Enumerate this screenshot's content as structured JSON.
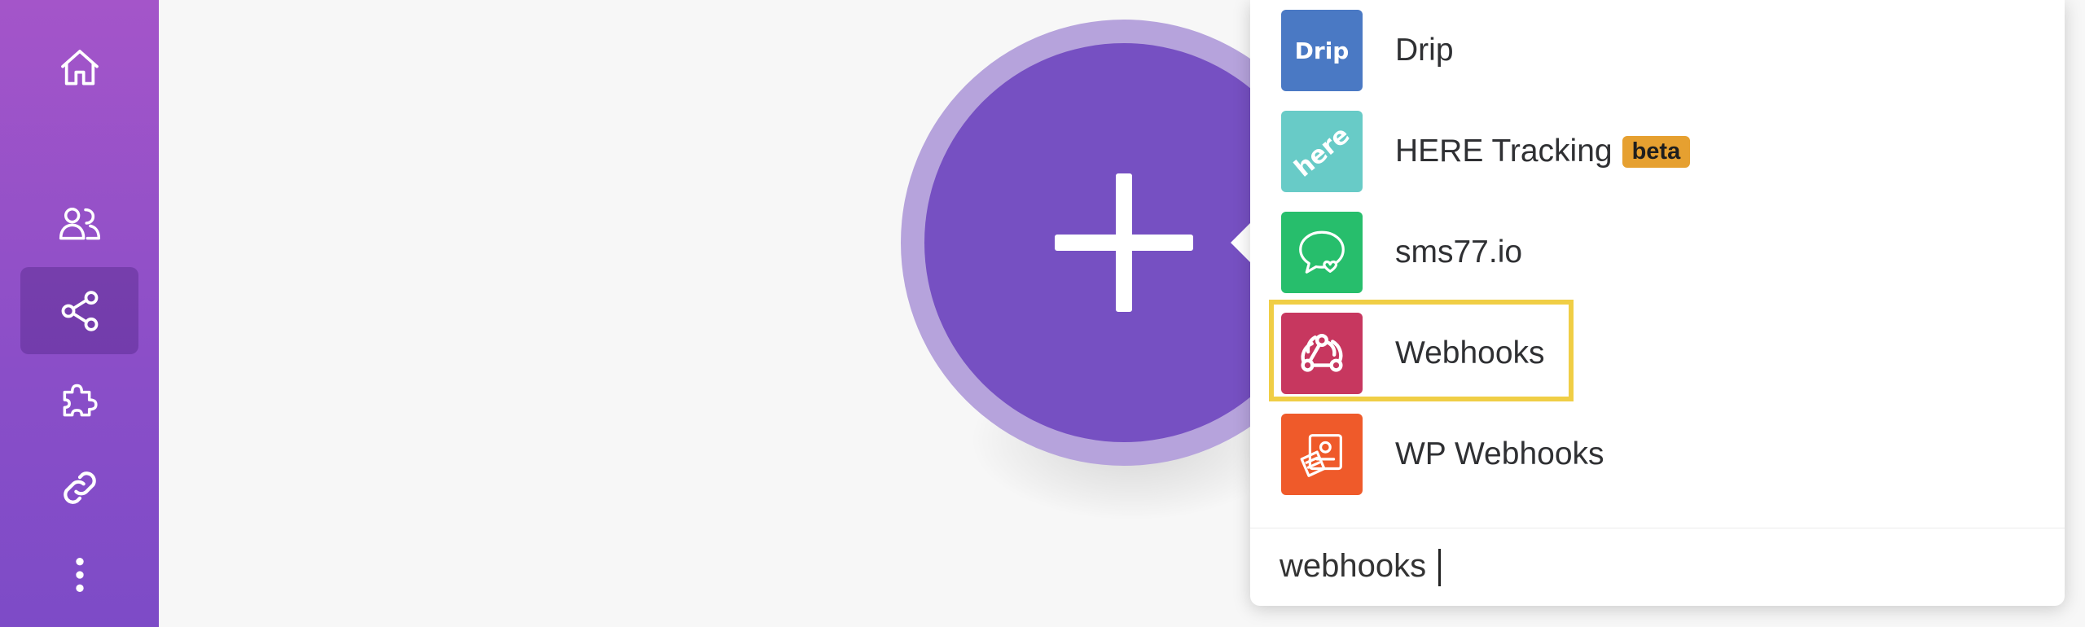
{
  "sidebar": {
    "items": [
      {
        "icon": "home-icon"
      },
      {
        "icon": "users-icon"
      },
      {
        "icon": "share-icon"
      },
      {
        "icon": "puzzle-icon"
      },
      {
        "icon": "link-icon"
      },
      {
        "icon": "more-vertical-icon"
      }
    ],
    "active_index": 2
  },
  "canvas": {
    "module_action": "add-module",
    "module_color": "#7650c2",
    "ring_color": "#b6a3dc"
  },
  "app_picker": {
    "apps": [
      {
        "label": "Drip",
        "icon": "drip-logo",
        "icon_text": "Drip",
        "color": "#4a79c4"
      },
      {
        "label": "HERE Tracking",
        "badge": "beta",
        "icon": "here-logo",
        "icon_text": "here",
        "color": "#68cbc7"
      },
      {
        "label": "sms77.io",
        "icon": "chat-heart-icon",
        "color": "#27be6c"
      },
      {
        "label": "Webhooks",
        "icon": "webhook-icon",
        "color": "#c7375f",
        "highlighted": true
      },
      {
        "label": "WP Webhooks",
        "icon": "wp-webhooks-logo",
        "color": "#ef5a2a"
      }
    ],
    "search": {
      "value": "webhooks"
    },
    "highlight_color": "#f0ce45",
    "badge_color": "#e6a030"
  }
}
